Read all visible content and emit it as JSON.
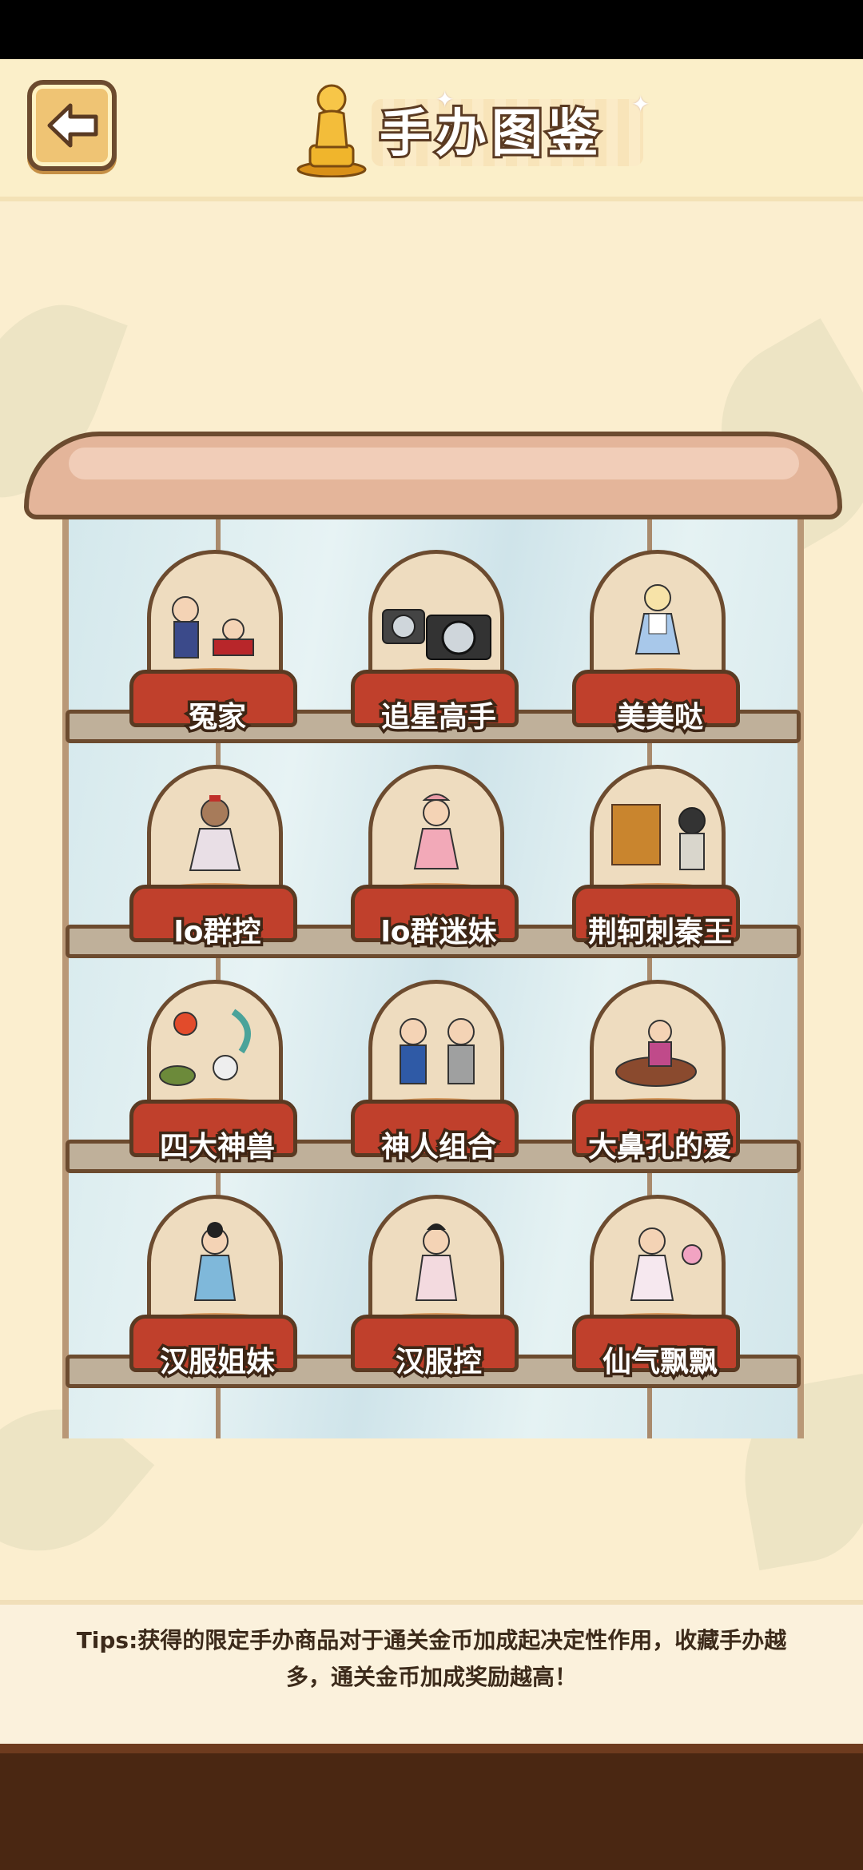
{
  "header": {
    "back_label": "back",
    "title": "手办图鉴"
  },
  "figures": [
    {
      "name": "冤家"
    },
    {
      "name": "追星高手"
    },
    {
      "name": "美美哒"
    },
    {
      "name": "lo群控"
    },
    {
      "name": "lo群迷妹"
    },
    {
      "name": "荆轲刺秦王"
    },
    {
      "name": "四大神兽"
    },
    {
      "name": "神人组合"
    },
    {
      "name": "大鼻孔的爱"
    },
    {
      "name": "汉服姐妹"
    },
    {
      "name": "汉服控"
    },
    {
      "name": "仙气飘飘"
    }
  ],
  "tips": {
    "line1": "Tips:获得的限定手办商品对于通关金币加成起决定性作用，收藏手办越",
    "line2": "多，通关金币加成奖励越高！"
  },
  "colors": {
    "background": "#fbeecf",
    "pedestal": "#c0402c",
    "outline": "#6c4b2f",
    "floor": "#4a2712"
  }
}
